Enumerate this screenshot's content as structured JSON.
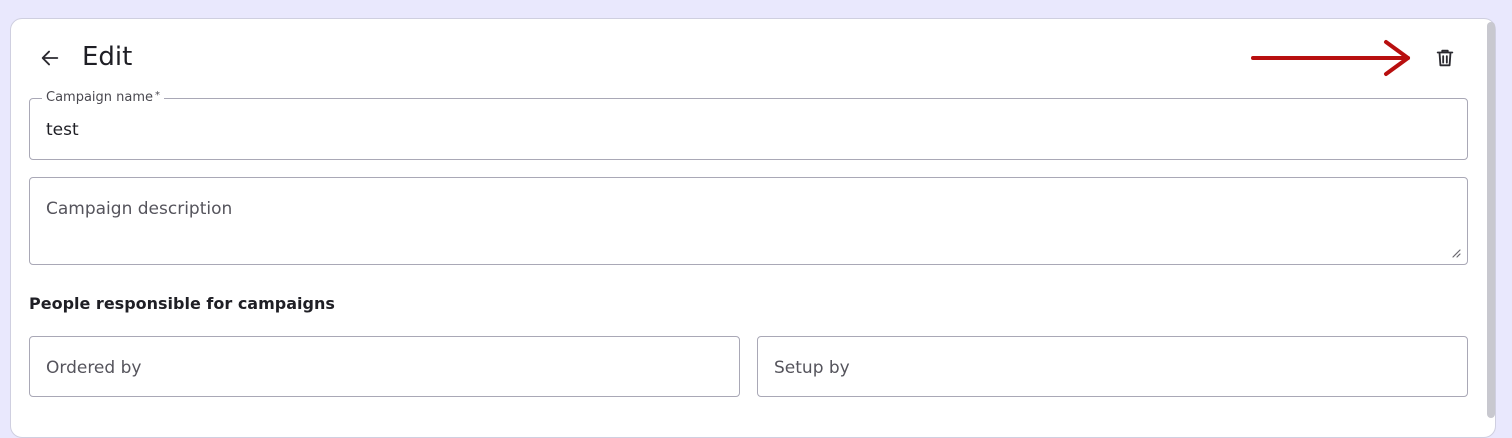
{
  "header": {
    "title": "Edit",
    "back_icon": "arrow-left-icon",
    "delete_icon": "trash-icon"
  },
  "form": {
    "campaign_name": {
      "label": "Campaign name",
      "required_mark": "*",
      "value": "test"
    },
    "campaign_description": {
      "placeholder": "Campaign description"
    },
    "responsible_section": {
      "heading": "People responsible for campaigns",
      "ordered_by": {
        "placeholder": "Ordered by"
      },
      "setup_by": {
        "placeholder": "Setup by"
      }
    }
  },
  "colors": {
    "background": "#e9e8fd",
    "card": "#ffffff",
    "field_border": "#a9a8b6",
    "annotation_arrow": "#b80f0f"
  }
}
